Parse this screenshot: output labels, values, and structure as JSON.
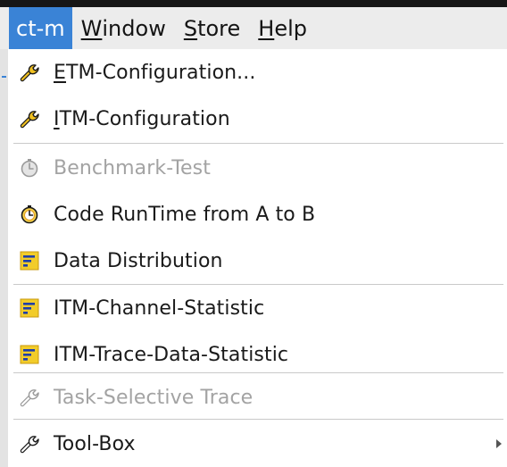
{
  "menubar": {
    "items": [
      {
        "text": "ct-m",
        "mnemonic": "",
        "rest": ""
      },
      {
        "text": "",
        "mnemonic": "W",
        "rest": "indow"
      },
      {
        "text": "",
        "mnemonic": "S",
        "rest": "tore"
      },
      {
        "text": "",
        "mnemonic": "H",
        "rest": "elp"
      }
    ]
  },
  "menu": {
    "etm": {
      "mnemonic": "E",
      "rest": "TM-Configuration...",
      "icon": "wrench-icon"
    },
    "itm": {
      "mnemonic": "I",
      "rest": "TM-Configuration",
      "icon": "wrench-icon"
    },
    "benchmark": {
      "label": "Benchmark-Test",
      "icon": "stopwatch-icon",
      "enabled": false
    },
    "coderuntime": {
      "label": "Code RunTime from A to B",
      "icon": "stopwatch-icon"
    },
    "datadist": {
      "label": "Data Distribution",
      "icon": "bar-list-icon"
    },
    "itmchannel": {
      "label": "ITM-Channel-Statistic",
      "icon": "bar-list-icon"
    },
    "itmtrace": {
      "label": "ITM-Trace-Data-Statistic",
      "icon": "bar-list-icon"
    },
    "taskselective": {
      "label": "Task-Selective Trace",
      "icon": "wrench-icon",
      "enabled": false
    },
    "toolbox": {
      "label": "Tool-Box",
      "icon": "wrench-icon",
      "submenu": true
    }
  },
  "colors": {
    "highlight": "#3a83d6",
    "disabled_text": "#a3a3a3",
    "icon_yellow": "#f0c020"
  }
}
